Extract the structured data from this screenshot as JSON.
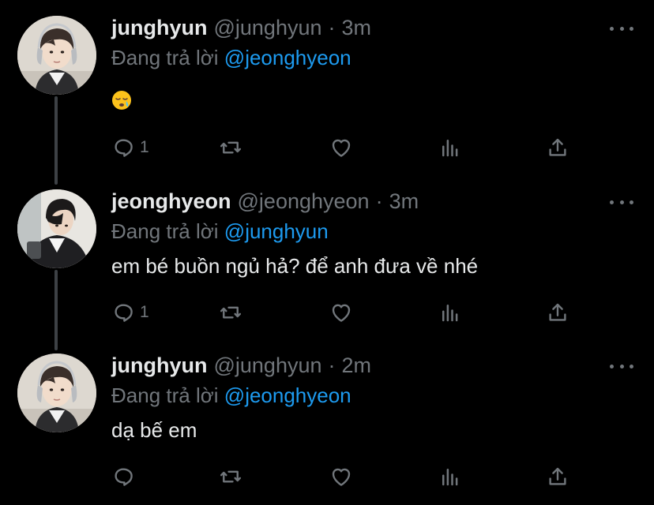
{
  "thread": {
    "tweets": [
      {
        "display_name": "junghyun",
        "handle": "@junghyun",
        "separator": "·",
        "time": "3m",
        "reply_prefix": "Đang trả lời",
        "reply_mention": "@jeonghyeon",
        "text": "",
        "emoji": "sleepy-face-emoji",
        "avatar": "avatar-photo-light-hair-headphones",
        "reply_count": "1",
        "icons": [
          "reply-icon",
          "retweet-icon",
          "like-icon",
          "analytics-icon",
          "share-icon",
          "more-icon"
        ]
      },
      {
        "display_name": "jeonghyeon",
        "handle": "@jeonghyeon",
        "separator": "·",
        "time": "3m",
        "reply_prefix": "Đang trả lời",
        "reply_mention": "@junghyun",
        "text": "em bé buồn ngủ hả? để anh đưa về nhé",
        "avatar": "avatar-photo-dark-hair-jacket",
        "reply_count": "1",
        "icons": [
          "reply-icon",
          "retweet-icon",
          "like-icon",
          "analytics-icon",
          "share-icon",
          "more-icon"
        ]
      },
      {
        "display_name": "junghyun",
        "handle": "@junghyun",
        "separator": "·",
        "time": "2m",
        "reply_prefix": "Đang trả lời",
        "reply_mention": "@jeonghyeon",
        "text": "dạ bế em",
        "avatar": "avatar-photo-light-hair-headphones",
        "reply_count": "",
        "icons": [
          "reply-icon",
          "retweet-icon",
          "like-icon",
          "analytics-icon",
          "share-icon",
          "more-icon"
        ]
      }
    ]
  },
  "colors": {
    "background": "#000000",
    "primary_text": "#e7e9ea",
    "secondary_text": "#71767b",
    "link": "#1d9bf0",
    "thread_line": "#3d4145"
  }
}
